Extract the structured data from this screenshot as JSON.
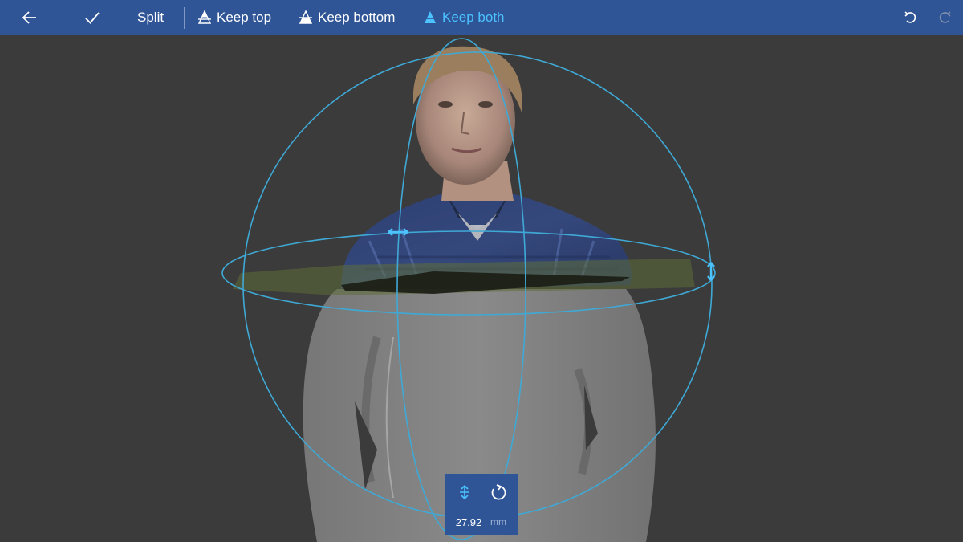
{
  "toolbar": {
    "back": "back-arrow-icon",
    "confirm": "checkmark-icon",
    "split_label": "Split",
    "keep_top_label": "Keep top",
    "keep_bottom_label": "Keep bottom",
    "keep_both_label": "Keep both",
    "undo": "undo-icon",
    "redo": "redo-icon",
    "active_mode": "Keep both"
  },
  "move_panel": {
    "move_icon": "move-vertical-icon",
    "rotate_icon": "rotate-icon",
    "value": "27.92",
    "unit": "mm"
  },
  "colors": {
    "toolbar_bg": "#2f5597",
    "accent": "#4cc2ff",
    "viewport_bg": "#3b3b3b",
    "gizmo": "#3fa9d6",
    "cut_plane": "#5f6e3a"
  }
}
